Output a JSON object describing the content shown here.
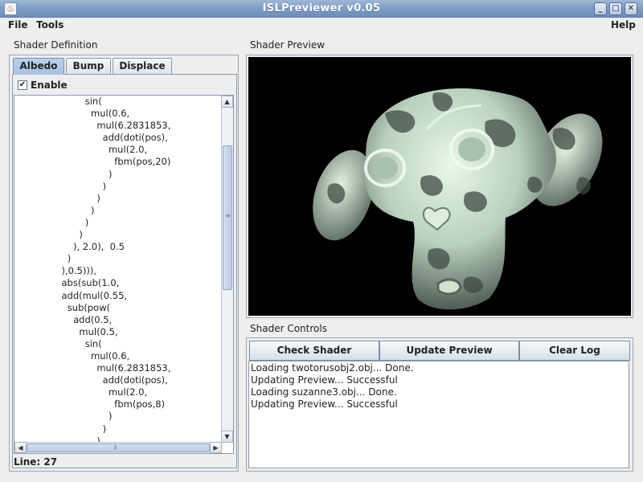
{
  "window": {
    "title": "ISLPreviewer v0.05",
    "controls": [
      "minimize",
      "maximize",
      "close"
    ]
  },
  "menubar": {
    "file": "File",
    "tools": "Tools",
    "help": "Help"
  },
  "shader_definition": {
    "title": "Shader Definition",
    "tabs": [
      {
        "label": "Albedo",
        "active": true
      },
      {
        "label": "Bump",
        "active": false
      },
      {
        "label": "Displace",
        "active": false
      }
    ],
    "enable_label": "Enable",
    "enable_checked": true,
    "code_lines": [
      "                        sin(",
      "                          mul(0.6,",
      "                            mul(6.2831853,",
      "                              add(doti(pos),",
      "                                mul(2.0,",
      "                                  fbm(pos,20)",
      "                                )",
      "                              )",
      "                            )",
      "                          )",
      "                        )",
      "                      )",
      "                    ), 2.0),  0.5",
      "                  )",
      "                ),0.5))),",
      "                abs(sub(1.0,",
      "                add(mul(0.55,",
      "                  sub(pow(",
      "                    add(0.5,",
      "                      mul(0.5,",
      "                        sin(",
      "                          mul(0.6,",
      "                            mul(6.2831853,",
      "                              add(doti(pos),",
      "                                mul(2.0,",
      "                                  fbm(pos,8)",
      "                                )",
      "                              )",
      "                            )"
    ],
    "status": "Line: 27"
  },
  "shader_preview": {
    "title": "Shader Preview",
    "background": "#000000",
    "model_colors": {
      "light": "#dcefdc",
      "mid": "#9fb7a6",
      "dark": "#3f4a44"
    }
  },
  "shader_controls": {
    "title": "Shader Controls",
    "buttons": {
      "check": "Check Shader",
      "update": "Update Preview",
      "clear": "Clear Log"
    },
    "log": [
      "Loading twotorusobj2.obj... Done.",
      "Updating Preview... Successful",
      "Loading suzanne3.obj... Done.",
      "Updating Preview... Successful"
    ]
  }
}
